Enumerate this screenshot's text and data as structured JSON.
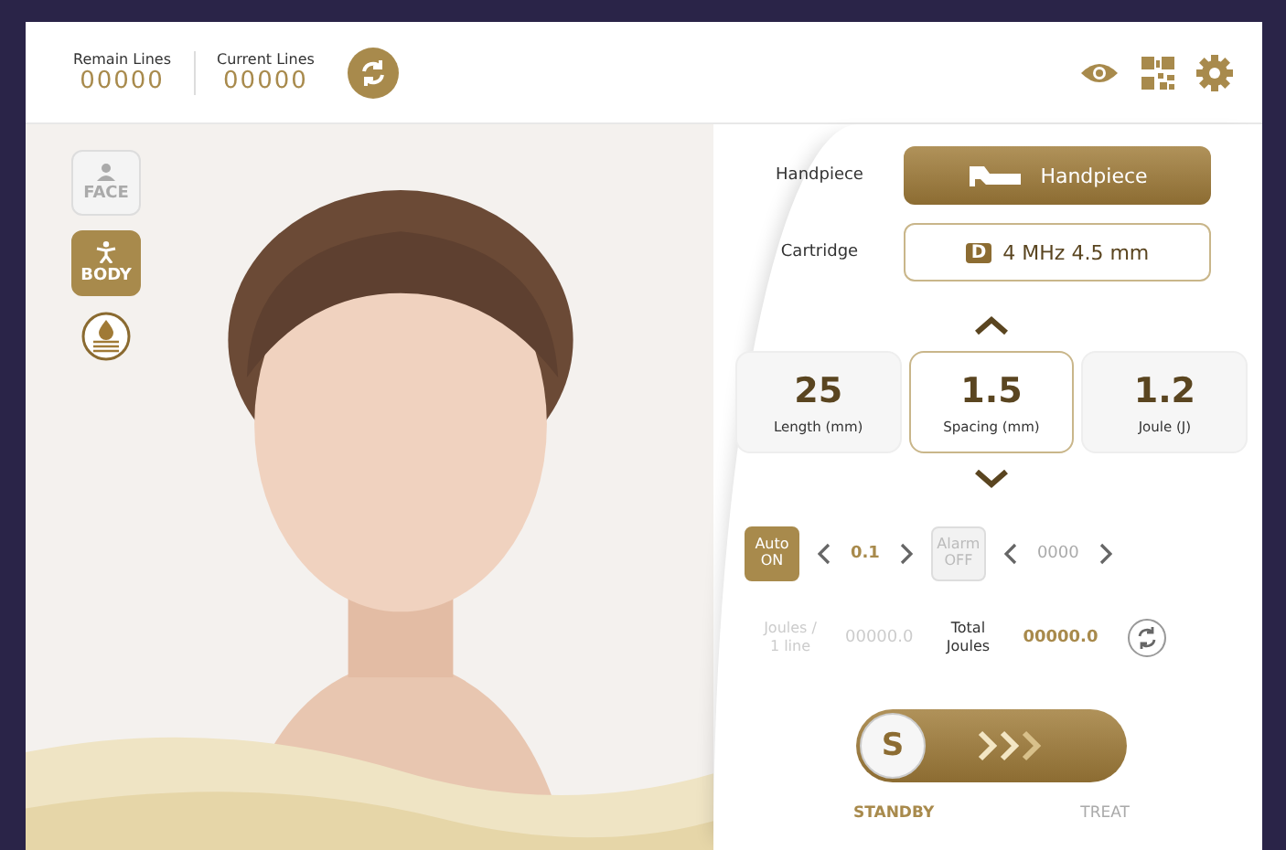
{
  "counters": [
    {
      "label": "Remain Lines",
      "value": "00000"
    },
    {
      "label": "Current Lines",
      "value": "00000"
    }
  ],
  "modes": [
    {
      "label": "FACE",
      "kind": "face",
      "selected": false
    },
    {
      "label": "BODY",
      "kind": "body",
      "selected": true
    }
  ],
  "handpiece": {
    "label": "Handpiece",
    "value": "Handpiece"
  },
  "cartridge": {
    "label": "Cartridge",
    "badge": "D",
    "value": "4 MHz 4.5 mm"
  },
  "params": [
    {
      "value": "25",
      "label": "Length (mm)",
      "selected": false
    },
    {
      "value": "1.5",
      "label": "Spacing (mm)",
      "selected": true
    },
    {
      "value": "1.2",
      "label": "Joule (J)",
      "selected": false
    }
  ],
  "toggles": [
    {
      "label": "Auto",
      "state": "ON",
      "on": true,
      "value": "0.1"
    },
    {
      "label": "Alarm",
      "state": "OFF",
      "on": false,
      "value": "0000"
    }
  ],
  "joules": [
    {
      "label": "Joules /\n1 line",
      "value": "00000.0",
      "disabled": true
    },
    {
      "label": "Total\nJoules",
      "value": "00000.0",
      "disabled": false
    }
  ],
  "switch": {
    "knob": "S",
    "on": false,
    "labels": [
      {
        "text": "STANDBY",
        "selected": true
      },
      {
        "text": "TREAT",
        "selected": false
      }
    ]
  }
}
